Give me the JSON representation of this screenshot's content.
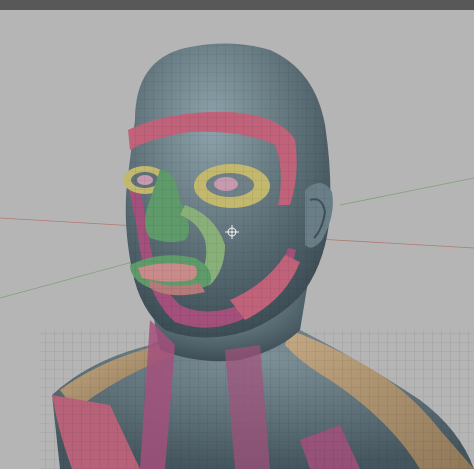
{
  "window": {
    "topbar_color": "#585858"
  },
  "viewport": {
    "background_color": "#b5b5b5",
    "icons": {
      "cursor": "crosshair-cursor-icon",
      "model": "head-bust-mesh"
    },
    "polygroup_colors": {
      "base_skin": "#5e7179",
      "forehead_band": "#c0627a",
      "cheek_band": "#a4507c",
      "eye_ring": "#c2b86e",
      "nose_lips": "#5e9a6a",
      "neck_shoulder": "#b59b74",
      "lips": "#c98a8a"
    }
  }
}
